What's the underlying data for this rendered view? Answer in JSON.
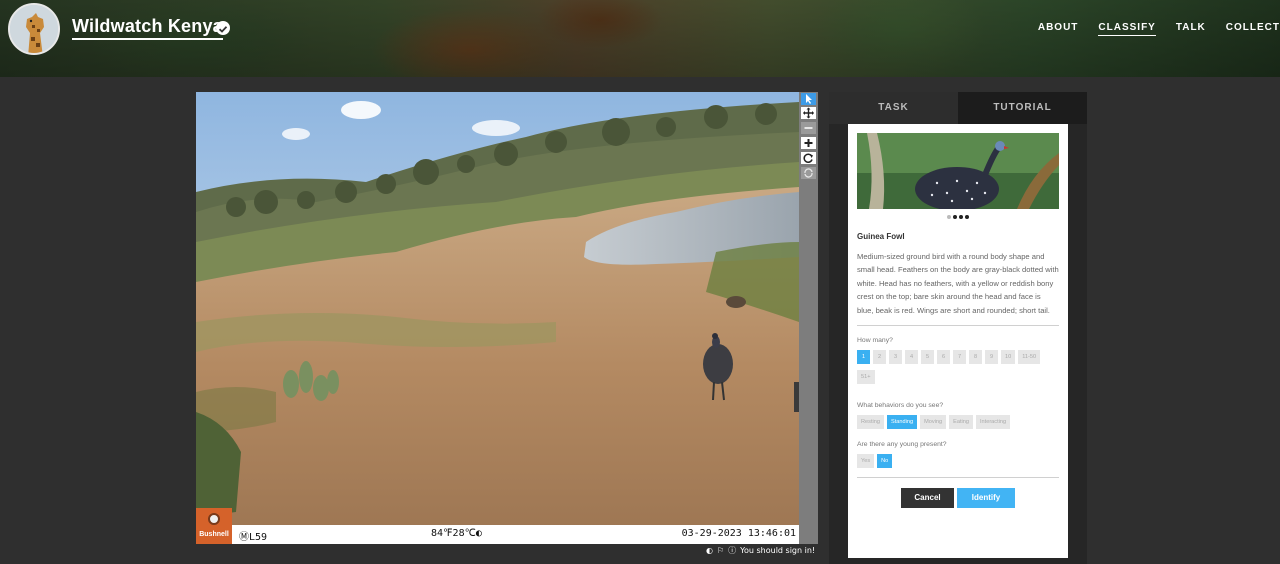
{
  "header": {
    "project_title": "Wildwatch Kenya",
    "nav": [
      "ABOUT",
      "CLASSIFY",
      "TALK",
      "COLLECT"
    ],
    "active_nav": "CLASSIFY"
  },
  "camera": {
    "brand": "Bushnell",
    "camera_id": "ⓂL59",
    "temperature": "84℉28℃◐",
    "timestamp": "03-29-2023 13:46:01"
  },
  "footer": {
    "sign_in_notice": "You should sign in!"
  },
  "tabs": [
    "TASK",
    "TUTORIAL"
  ],
  "field_guide": {
    "species_name": "Guinea Fowl",
    "description": "Medium-sized ground bird with a round body shape and small head. Feathers on the body are gray-black dotted with white. Head has no feathers, with a yellow or reddish bony crest on the top; bare skin around the head and face is blue, beak is red. Wings are short and rounded; short tail."
  },
  "questions": {
    "how_many": {
      "label": "How many?",
      "options": [
        "1",
        "2",
        "3",
        "4",
        "5",
        "6",
        "7",
        "8",
        "9",
        "10",
        "11-50",
        "51+"
      ],
      "selected": "1"
    },
    "behaviors": {
      "label": "What behaviors do you see?",
      "options": [
        "Resting",
        "Standing",
        "Moving",
        "Eating",
        "Interacting"
      ],
      "selected": "Standing"
    },
    "young": {
      "label": "Are there any young present?",
      "options": [
        "Yes",
        "No"
      ],
      "selected": "No"
    }
  },
  "actions": {
    "cancel": "Cancel",
    "identify": "Identify"
  },
  "colors": {
    "accent": "#3ab0f1",
    "cancel": "#333333",
    "page_bg": "#2f2f2f"
  },
  "icons": {
    "toolbar": [
      "pointer-icon",
      "move-icon",
      "zoom-out-icon",
      "zoom-in-icon",
      "rotate-icon",
      "reset-icon"
    ]
  }
}
